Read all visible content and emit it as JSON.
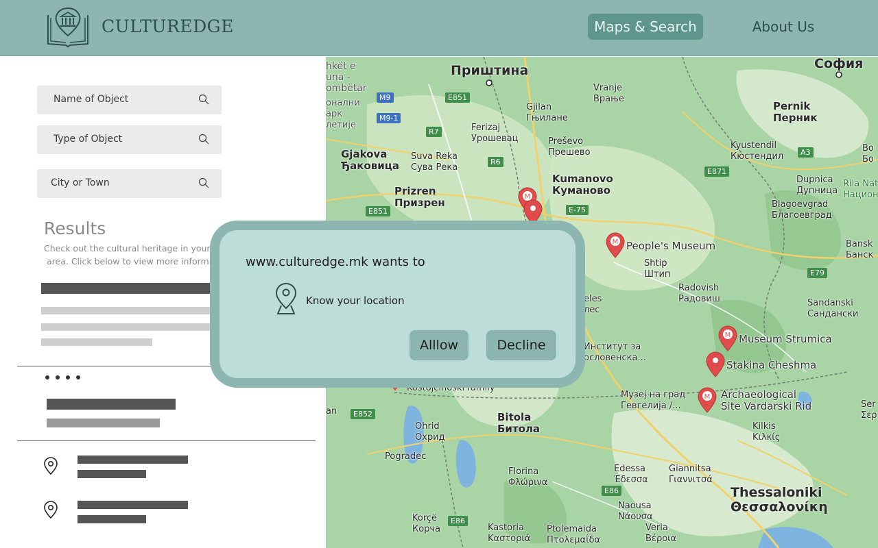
{
  "header": {
    "logo_text": "CULTUREDGE",
    "nav": [
      {
        "label": "Maps & Search",
        "active": true
      },
      {
        "label": "About Us",
        "active": false
      }
    ],
    "colors": {
      "header_bg": "#8db6b0",
      "active_nav_bg": "#5e958d"
    }
  },
  "sidebar": {
    "search_fields": [
      {
        "placeholder": "Name of Object",
        "icon": "search-icon"
      },
      {
        "placeholder": "Type of Object",
        "icon": "search-icon"
      },
      {
        "placeholder": "City or Town",
        "icon": "search-icon"
      }
    ],
    "results_title": "Results",
    "results_desc_line1": "Check out the cultural heritage in your",
    "results_desc_line2": "area. Click below to view more informa",
    "dots": "••••"
  },
  "modal": {
    "title": "www.culturedge.mk wants to",
    "permission": "Know your location",
    "allow_label": "Alllow",
    "decline_label": "Decline"
  },
  "map": {
    "cities": [
      {
        "latin": "hkët e",
        "cyr": "una -",
        "extra": "ombëtar"
      },
      {
        "name": "Приштина"
      },
      {
        "name": "София"
      },
      {
        "name": "Vranje",
        "cyr": "Врање"
      },
      {
        "name": "Gjilan",
        "cyr": "Гњилане"
      },
      {
        "name": "Ferizaj",
        "cyr": "Урошевац"
      },
      {
        "name": "Preševo",
        "cyr": "Прешево"
      },
      {
        "name": "Pernik",
        "cyr": "Перник"
      },
      {
        "name": "Kyustendil",
        "cyr": "Кюстендил"
      },
      {
        "name": "Gjakova",
        "cyr": "Ђаковица"
      },
      {
        "name": "Suva Reka",
        "cyr": "Сува Река"
      },
      {
        "name": "Kumanovo",
        "cyr": "Куманово"
      },
      {
        "name": "Dupnica",
        "cyr": "Дупница"
      },
      {
        "name": "Prizren",
        "cyr": "Призрен"
      },
      {
        "name": "Blagoevgrad",
        "cyr": "Благоевград"
      },
      {
        "name": "Rila Nat",
        "cyr": "Национ"
      },
      {
        "name": "Shtip",
        "cyr": "Штип"
      },
      {
        "name": "Radovish",
        "cyr": "Радовиш"
      },
      {
        "name": "Bansk",
        "cyr": "Банск"
      },
      {
        "name": "Sandanski",
        "cyr": "Сандански"
      },
      {
        "name": "Институт за",
        "cyr": "ословенска..."
      },
      {
        "name": "Kostojcinoski family"
      },
      {
        "name": "Музеј на град",
        "cyr": "Гевгелија /..."
      },
      {
        "name": "Bitola",
        "cyr": "Битола"
      },
      {
        "name": "Ohrid",
        "cyr": "Охрид"
      },
      {
        "name": "Kilkis",
        "cyr": "Κιλκίς"
      },
      {
        "name": "Pogradec"
      },
      {
        "name": "Florina",
        "cyr": "Φλώρινα"
      },
      {
        "name": "Edessa",
        "cyr": "Έδεσσα"
      },
      {
        "name": "Giannitsa",
        "cyr": "Γιαννιτσά"
      },
      {
        "name": "Thessaloniki",
        "cyr": "Θεσσαλονίκη"
      },
      {
        "name": "Naousa",
        "cyr": "Νάουσα"
      },
      {
        "name": "Veria",
        "cyr": "Βέροια"
      },
      {
        "name": "Korçë",
        "cyr": "Корча"
      },
      {
        "name": "Kastoria",
        "cyr": "Καστοριά"
      },
      {
        "name": "Ptolemaida",
        "cyr": "Πτολεμαΐδα"
      },
      {
        "name": "Ser",
        "cyr": "Σερ"
      },
      {
        "name": "Bo",
        "cyr": "Бо"
      },
      {
        "name": "eles",
        "cyr": "лес"
      },
      {
        "name": "an"
      },
      {
        "name": "арк",
        "cyr": "летије"
      },
      {
        "name": "онални"
      }
    ],
    "pois": [
      "People's Museum",
      "Museum Strumica",
      "Stakina Cheshma",
      "Archaeological",
      "Site Vardarski Rid"
    ],
    "roads": [
      "M9",
      "M9-1",
      "E851",
      "R7",
      "R6",
      "E-75",
      "E851",
      "E871",
      "A3",
      "E79",
      "E852",
      "E86",
      "E86"
    ],
    "colors": {
      "land": "#a9d5a6",
      "marker": "#e04c4c",
      "water": "#7fb3e0"
    }
  }
}
